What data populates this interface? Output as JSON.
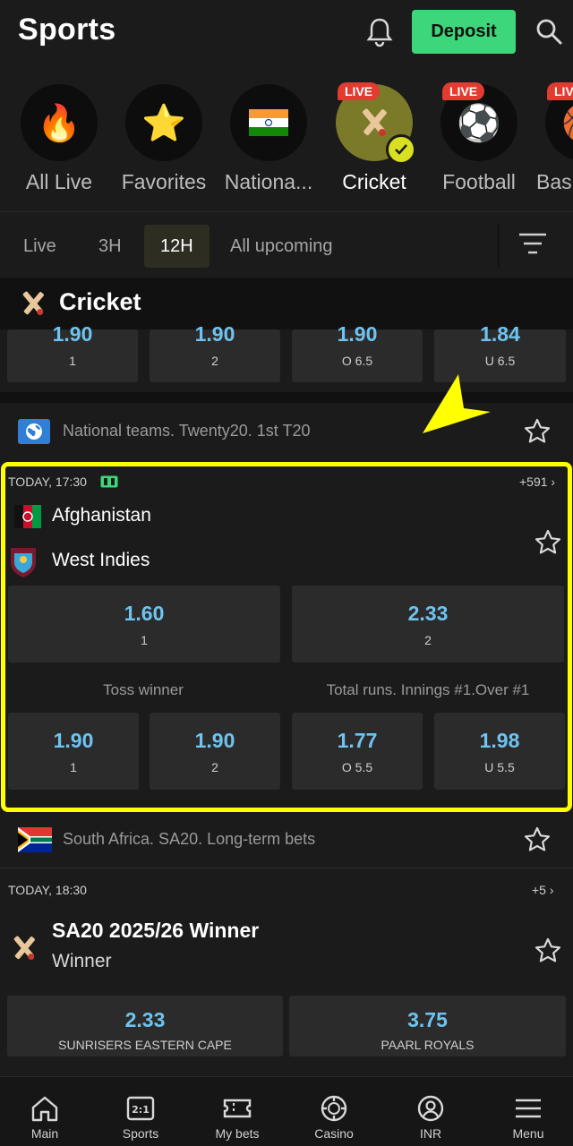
{
  "header": {
    "title": "Sports",
    "deposit_label": "Deposit"
  },
  "categories": [
    {
      "label": "All Live",
      "icon": "fire-icon",
      "live": false
    },
    {
      "label": "Favorites",
      "icon": "star-icon",
      "live": false
    },
    {
      "label": "Nationa...",
      "icon": "india-flag-icon",
      "live": false
    },
    {
      "label": "Cricket",
      "icon": "cricket-icon",
      "live": true,
      "active": true
    },
    {
      "label": "Football",
      "icon": "football-icon",
      "live": true
    },
    {
      "label": "Bas",
      "icon": "basketball-icon",
      "live": true
    }
  ],
  "live_badge": "LIVE",
  "time_filters": [
    {
      "label": "Live"
    },
    {
      "label": "3H"
    },
    {
      "label": "12H",
      "active": true
    },
    {
      "label": "All upcoming"
    }
  ],
  "section": {
    "title": "Cricket"
  },
  "prev_odds": [
    {
      "value": "1.90",
      "key": "1"
    },
    {
      "value": "1.90",
      "key": "2"
    },
    {
      "value": "1.90",
      "key": "O 6.5"
    },
    {
      "value": "1.84",
      "key": "U 6.5"
    }
  ],
  "match1": {
    "league": "National teams. Twenty20. 1st T20",
    "time": "TODAY, 17:30",
    "more": "+591 ›",
    "team1": "Afghanistan",
    "team2": "West Indies",
    "main_odds": [
      {
        "value": "1.60",
        "key": "1"
      },
      {
        "value": "2.33",
        "key": "2"
      }
    ],
    "market1": "Toss winner",
    "market2": "Total runs. Innings #1.Over #1",
    "sub_odds": [
      {
        "value": "1.90",
        "key": "1"
      },
      {
        "value": "1.90",
        "key": "2"
      },
      {
        "value": "1.77",
        "key": "O 5.5"
      },
      {
        "value": "1.98",
        "key": "U 5.5"
      }
    ]
  },
  "match2": {
    "league": "South Africa. SA20. Long-term bets",
    "time": "TODAY, 18:30",
    "more": "+5 ›",
    "title": "SA20 2025/26 Winner",
    "subtitle": "Winner",
    "odds": [
      {
        "value": "2.33",
        "key": "SUNRISERS EASTERN CAPE"
      },
      {
        "value": "3.75",
        "key": "PAARL ROYALS"
      }
    ]
  },
  "bottom_nav": [
    {
      "label": "Main",
      "icon": "home-icon"
    },
    {
      "label": "Sports",
      "icon": "sports-icon"
    },
    {
      "label": "My bets",
      "icon": "ticket-icon"
    },
    {
      "label": "Casino",
      "icon": "casino-chip-icon"
    },
    {
      "label": "INR",
      "icon": "user-icon"
    },
    {
      "label": "Menu",
      "icon": "menu-icon"
    }
  ],
  "colors": {
    "accent_green": "#3ed67a",
    "odds_blue": "#6ec4f0",
    "highlight_yellow": "#ffff00",
    "live_red": "#e23b30"
  }
}
